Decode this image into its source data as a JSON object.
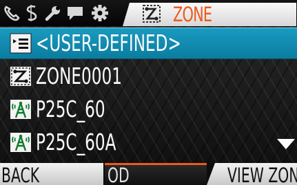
{
  "tabs": {
    "icons": [
      "phone-icon",
      "signal-icon",
      "wrench-icon",
      "message-icon",
      "gear-icon"
    ],
    "active": {
      "icon": "zone-icon",
      "label": "ZONE"
    }
  },
  "list": {
    "items": [
      {
        "label": "<USER-DEFINED>",
        "icon": "list-icon",
        "selected": true
      },
      {
        "label": "ZONE0001",
        "icon": "zone-icon",
        "selected": false
      },
      {
        "label": "P25C_60",
        "icon": "tower-icon",
        "selected": false
      },
      {
        "label": "P25C_60A",
        "icon": "tower-icon",
        "selected": false
      }
    ]
  },
  "softkeys": {
    "left": "BACK",
    "middle": "OD",
    "right": "VIEW ZON"
  },
  "colors": {
    "accent": "#ee5a1c",
    "selection": "#1489b0"
  }
}
